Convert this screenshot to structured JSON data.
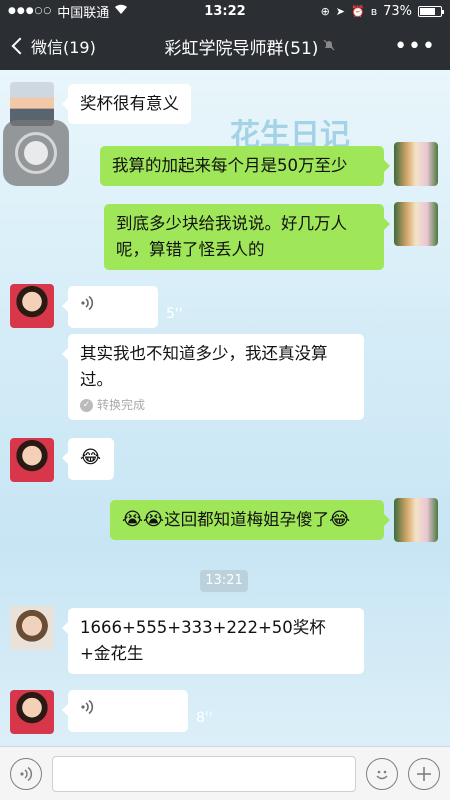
{
  "status": {
    "carrier": "中国联通",
    "time": "13:22",
    "battery": "73%",
    "battery_level": 0.73
  },
  "nav": {
    "back_label": "微信(19)",
    "title": "彩虹学院导师群(51)",
    "more_label": "•••"
  },
  "messages": {
    "m1": "奖杯很有意义",
    "m2": "我算的加起来每个月是50万至少",
    "m3": "到底多少块给我说说。好几万人呢，算错了怪丢人的",
    "m4_duration": "5''",
    "m5": "其实我也不知道多少，我还真没算过。",
    "m5_status": "转换完成",
    "m6_emoji": "😂",
    "m7": "这回都知道梅姐孕傻了",
    "time_divider": "13:21",
    "m8": "1666+555+333+222+50奖杯+金花生",
    "m9_duration": "8''"
  },
  "background_deco": "花生日记",
  "icons": {
    "voice": "voice-wave-icon",
    "emoji": "smiley-icon",
    "add": "plus-icon",
    "mute": "mute-bell-icon"
  },
  "colors": {
    "bar": "#2b2e33",
    "outgoing_bubble": "#9fe658",
    "incoming_bubble": "#ffffff"
  }
}
